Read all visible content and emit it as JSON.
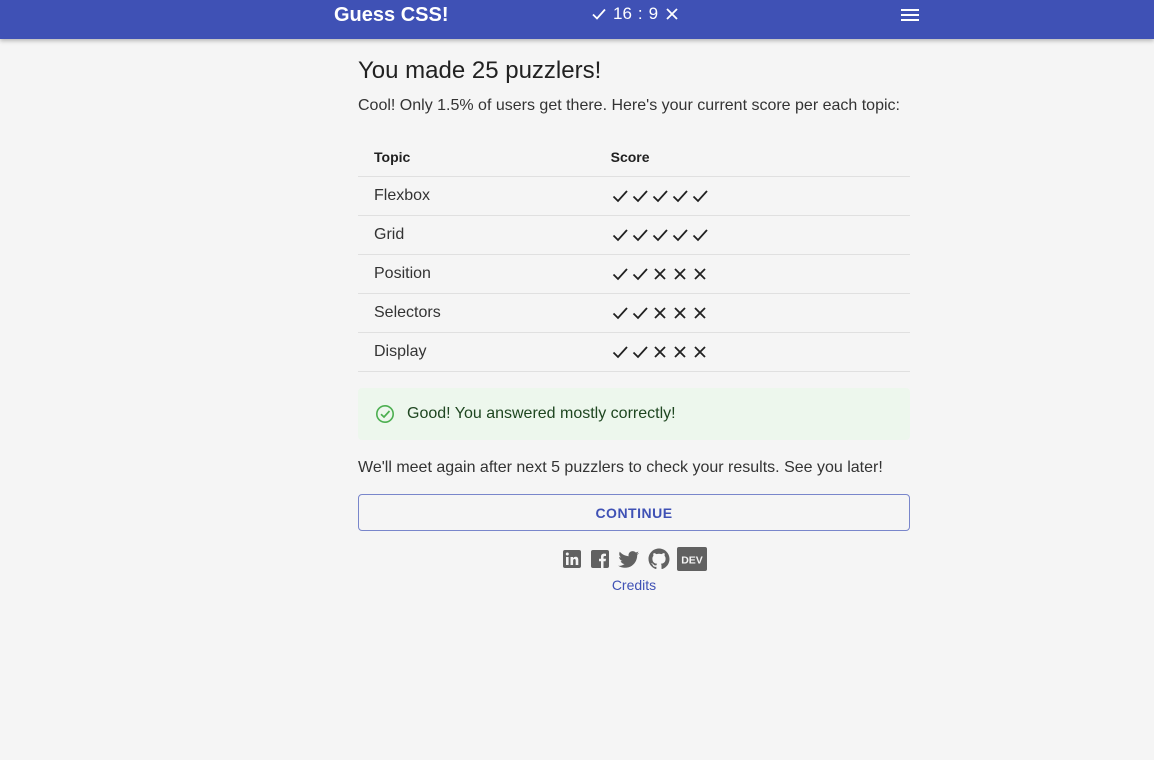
{
  "header": {
    "title": "Guess CSS!",
    "correct_count": "16",
    "separator": ":",
    "wrong_count": "9",
    "correct_icon": "check-icon",
    "wrong_icon": "close-icon",
    "menu_icon": "menu-icon"
  },
  "main": {
    "heading": "You made 25 puzzlers!",
    "intro": "Cool! Only 1.5% of users get there. Here's your current score per each topic:",
    "table": {
      "columns": [
        "Topic",
        "Score"
      ],
      "rows": [
        {
          "topic": "Flexbox",
          "marks": [
            "check",
            "check",
            "check",
            "check",
            "check"
          ]
        },
        {
          "topic": "Grid",
          "marks": [
            "check",
            "check",
            "check",
            "check",
            "check"
          ]
        },
        {
          "topic": "Position",
          "marks": [
            "check",
            "check",
            "cross",
            "cross",
            "cross"
          ]
        },
        {
          "topic": "Selectors",
          "marks": [
            "check",
            "check",
            "cross",
            "cross",
            "cross"
          ]
        },
        {
          "topic": "Display",
          "marks": [
            "check",
            "check",
            "cross",
            "cross",
            "cross"
          ]
        }
      ]
    },
    "alert": {
      "icon": "check-circle-icon",
      "text": "Good! You answered mostly correctly!"
    },
    "outro": "We'll meet again after next 5 puzzlers to check your results. See you later!",
    "continue_label": "CONTINUE"
  },
  "footer": {
    "socials": [
      "linkedin-icon",
      "facebook-icon",
      "twitter-icon",
      "github-icon",
      "dev-icon"
    ],
    "dev_label": "DEV",
    "credits_label": "Credits"
  },
  "colors": {
    "appbar": "#3f51b5",
    "background": "#f5f5f5",
    "alert_bg": "#edf7ed",
    "alert_icon": "#4caf50",
    "accent": "#3f51b5"
  }
}
